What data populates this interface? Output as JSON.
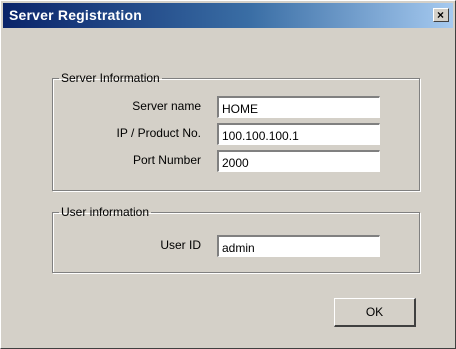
{
  "window": {
    "title": "Server Registration",
    "close_glyph": "×",
    "colors": {
      "titlebar_start": "#0a246a",
      "titlebar_end": "#a6caf0",
      "face": "#d4d0c8"
    }
  },
  "server_group": {
    "legend": "Server Information",
    "server_name_label": "Server name",
    "server_name_value": "HOME",
    "ip_label": "IP / Product No.",
    "ip_value": "100.100.100.1",
    "port_label": "Port Number",
    "port_value": "2000"
  },
  "user_group": {
    "legend": "User information",
    "user_id_label": "User ID",
    "user_id_value": "admin"
  },
  "buttons": {
    "ok_label": "OK"
  }
}
